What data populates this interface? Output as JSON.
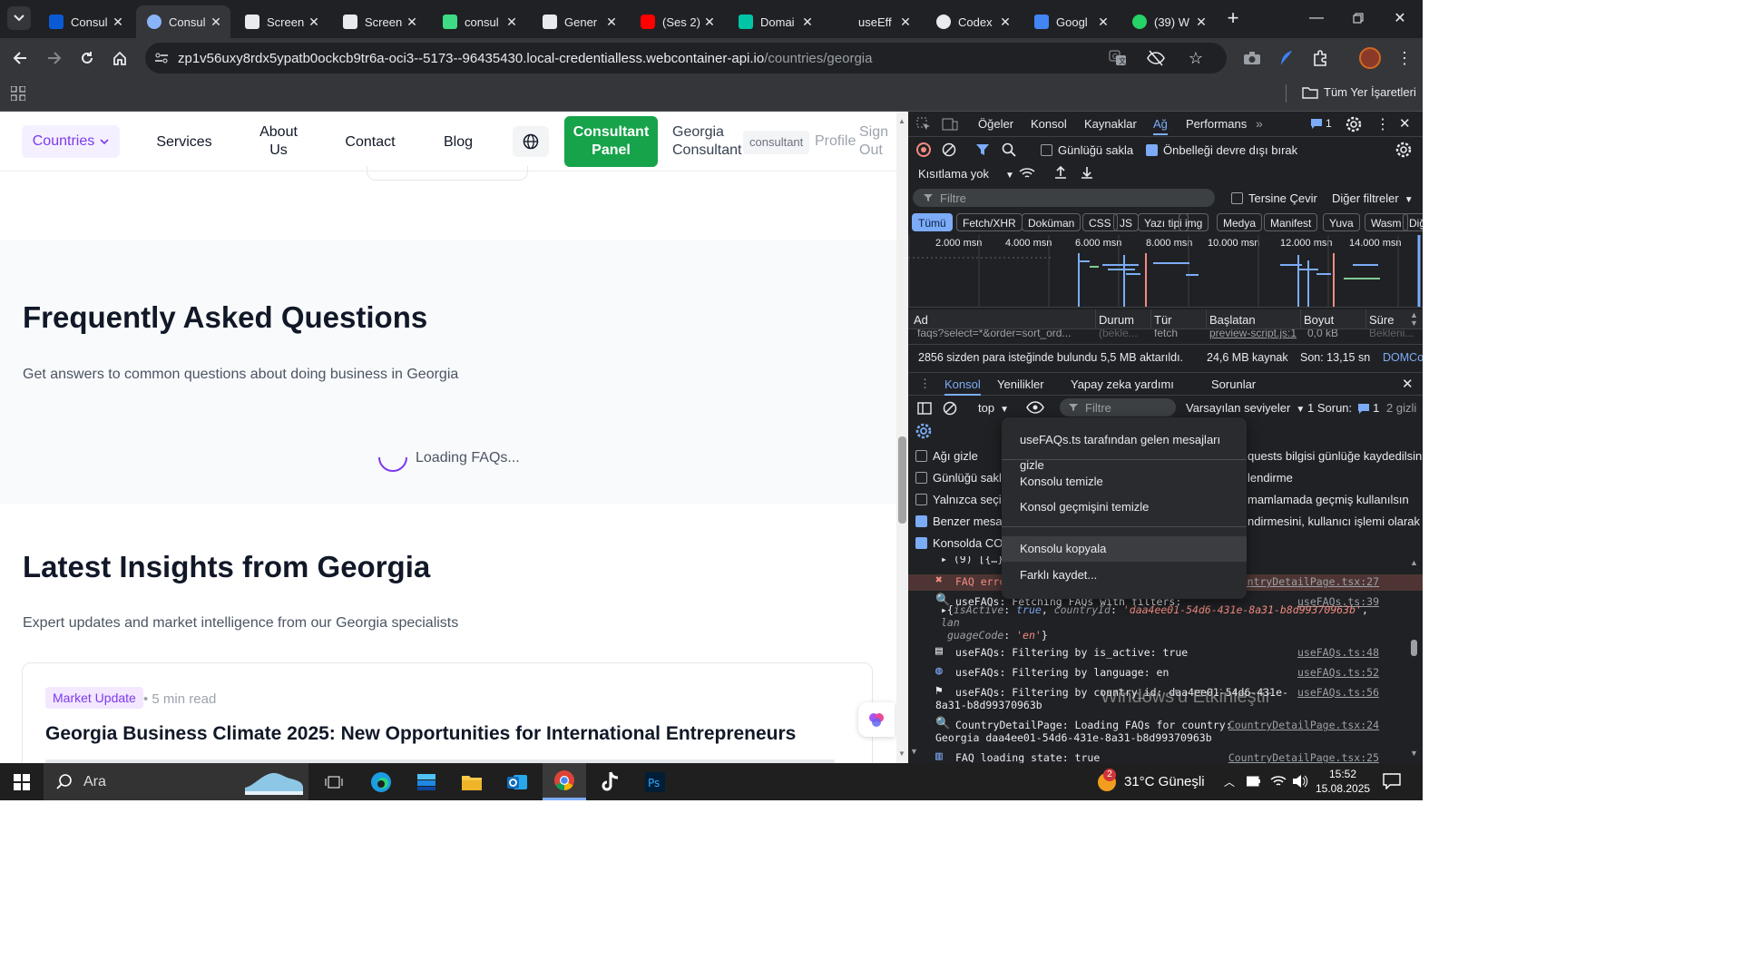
{
  "browser": {
    "tabs": [
      {
        "title": "Consul",
        "favicon": "bing-icon",
        "color": "#0a5ad4"
      },
      {
        "title": "Consul",
        "favicon": "globe-pin-icon",
        "color": "#8ab4f8",
        "active": true
      },
      {
        "title": "Screen",
        "favicon": "camera-icon",
        "color": "#e8eaed"
      },
      {
        "title": "Screen",
        "favicon": "camera-icon",
        "color": "#e8eaed"
      },
      {
        "title": "consul",
        "favicon": "bolt-icon",
        "color": "#3ddc84"
      },
      {
        "title": "Gener",
        "favicon": "r-icon",
        "color": "#e8eaed"
      },
      {
        "title": "(Ses 2)",
        "favicon": "youtube-icon",
        "color": "#ff0000"
      },
      {
        "title": "Domai",
        "favicon": "diamond-icon",
        "color": "#00c4a7"
      },
      {
        "title": "useEff",
        "favicon": "none",
        "color": "#202124"
      },
      {
        "title": "Codex",
        "favicon": "openai-icon",
        "color": "#e8eaed"
      },
      {
        "title": "Googl",
        "favicon": "translate-icon",
        "color": "#4285f4"
      },
      {
        "title": "(39) W",
        "favicon": "whatsapp-icon",
        "color": "#25d366"
      }
    ],
    "url_host": "zp1v56uxy8rdx5ypatb0ockcb9tr6a-oci3--5173--96435430.local-credentialless.webcontainer-api.io",
    "url_path": "/countries/georgia",
    "bookmarks_label": "Tüm Yer İşaretleri"
  },
  "site": {
    "nav": {
      "countries": "Countries",
      "services": "Services",
      "about_line1": "About",
      "about_line2": "Us",
      "contact": "Contact",
      "blog": "Blog",
      "panel_line1": "Consultant",
      "panel_line2": "Panel",
      "user_line1": "Georgia",
      "user_line2": "Consultant",
      "role_badge": "consultant",
      "profile": "Profile",
      "signout_line1": "Sign",
      "signout_line2": "Out"
    },
    "faq": {
      "title": "Frequently Asked Questions",
      "subtitle": "Get answers to common questions about doing business in Georgia",
      "loading": "Loading FAQs..."
    },
    "insights": {
      "title": "Latest Insights from Georgia",
      "subtitle": "Expert updates and market intelligence from our Georgia specialists",
      "card_tag": "Market Update",
      "card_read": "• 5 min read",
      "card_title": "Georgia Business Climate 2025: New Opportunities for International Entrepreneurs"
    }
  },
  "devtools": {
    "tabs": [
      "Öğeler",
      "Konsol",
      "Kaynaklar",
      "Ağ",
      "Performans"
    ],
    "active_tab": "Ağ",
    "issues_count": "1",
    "network": {
      "preserve_log": "Günlüğü sakla",
      "disable_cache": "Önbelleği devre dışı bırak",
      "throttle": "Kısıtlama yok",
      "filter_placeholder": "Filtre",
      "invert": "Tersine Çevir",
      "more_filters": "Diğer filtreler",
      "types": [
        "Tümü",
        "Fetch/XHR",
        "Doküman",
        "CSS",
        "JS",
        "Yazı tipi",
        "img",
        "Medya",
        "Manifest",
        "Yuva",
        "Wasm",
        "Diğ"
      ],
      "timeline_labels": [
        "2.000 msn",
        "4.000 msn",
        "6.000 msn",
        "8.000 msn",
        "10.000 msn",
        "12.000 msn",
        "14.000 msn"
      ],
      "columns": [
        "Ad",
        "Durum",
        "Tür",
        "Başlatan",
        "Boyut",
        "Süre"
      ],
      "row": {
        "name": "faqs?select=*&order=sort_ord...",
        "status": "(bekle...",
        "type": "fetch",
        "initiator": "preview-script.js:1",
        "size": "0,0 kB",
        "time": "Bekleni..."
      },
      "summary_requests": "2856 sizden para isteğinde bulundu",
      "summary_transferred": "5,5 MB aktarıldı.",
      "summary_resources": "24,6 MB kaynak",
      "summary_finish": "Son: 13,15 sn",
      "summary_dom": "DOMCo"
    },
    "drawer": {
      "tabs": [
        "Konsol",
        "Yenilikler",
        "Yapay zeka yardımı",
        "Sorunlar"
      ],
      "context": "top",
      "filter_placeholder": "Filtre",
      "levels": "Varsayılan seviyeler",
      "issues": "1 Sorun:",
      "issues_count": "1",
      "hidden": "2 gizli",
      "settings": [
        {
          "label": "Ağı gizle",
          "checked": false
        },
        {
          "label": "Günlüğü sakla",
          "checked": false
        },
        {
          "label": "Yalnızca seçili l",
          "checked": false
        },
        {
          "label": "Benzer mesajla",
          "checked": true
        },
        {
          "label": "Konsolda COR",
          "checked": true
        }
      ],
      "settings_right": [
        "quests bilgisi günlüğe kaydedilsin",
        "lendirme",
        "mamlamada geçmiş kullanılsın",
        "ndirmesini, kullanıcı işlemi olarak ..."
      ]
    },
    "console_logs": [
      {
        "icon": "error-icon",
        "text": "FAQ erro",
        "src": "CountryDetailPage.tsx:27",
        "color": "#f28b82"
      },
      {
        "icon": "search-icon",
        "text": "useFAQs: Fetching FAQs with filters:",
        "src": "useFAQs.ts:39",
        "color": "#e8eaed"
      },
      {
        "icon": "page-icon",
        "text": "useFAQs: Filtering by is_active: true",
        "src": "useFAQs.ts:48",
        "color": "#e8eaed"
      },
      {
        "icon": "globe-icon",
        "text": "useFAQs: Filtering by language: en",
        "src": "useFAQs.ts:52",
        "color": "#e8eaed"
      },
      {
        "icon": "flag-icon",
        "text": "useFAQs: Filtering by country_id: daa4ee01-54d6-431e-",
        "text2": "8a31-b8d99370963b",
        "src": "useFAQs.ts:56",
        "color": "#e8eaed"
      },
      {
        "icon": "search-icon",
        "text": "CountryDetailPage: Loading FAQs for country:",
        "text2": "Georgia daa4ee01-54d6-431e-8a31-b8d99370963b",
        "src": "CountryDetailPage.tsx:24",
        "color": "#e8eaed"
      },
      {
        "icon": "chart-icon",
        "text": "FAQ loading state: true",
        "src": "CountryDetailPage.tsx:25",
        "color": "#e8eaed"
      }
    ],
    "object_preview": {
      "prefix": "▸{",
      "k1": "isActive",
      "v1": "true",
      "k2": "countryId",
      "v2": "'daa4ee01-54d6-431e-8a31-b8d99370963b'",
      "k3": "lan",
      "k3b": "guageCode",
      "v3": "'en'"
    },
    "array_line": "▸ (9) [{…},"
  },
  "context_menu": {
    "items": [
      "useFAQs.ts tarafından gelen mesajları gizle",
      "Konsolu temizle",
      "Konsol geçmişini temizle",
      "Konsolu kopyala",
      "Farklı kaydet..."
    ],
    "hovered": "Konsolu kopyala"
  },
  "watermark": "Windows'u Etkinleştir",
  "taskbar": {
    "search": "Ara",
    "weather": "31°C Güneşli",
    "time": "15:52",
    "date": "15.08.2025",
    "weather_badge": "2"
  }
}
